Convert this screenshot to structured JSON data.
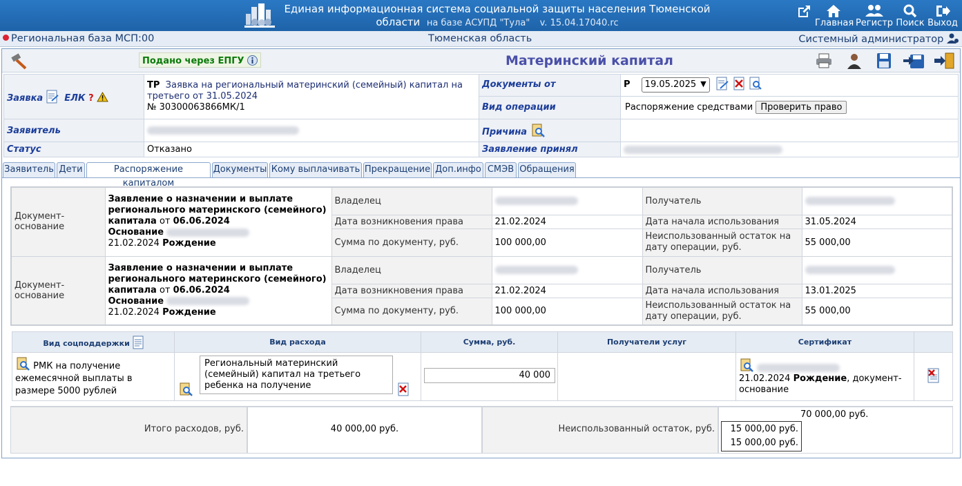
{
  "header": {
    "title_line1": "Единая информационная система социальной защиты населения Тюменской",
    "title_line2": "области",
    "base": "на базе АСУПД \"Тула\"",
    "version": "v. 15.04.17040.rc",
    "nav": [
      {
        "label": "Главная",
        "icon": "home-icon"
      },
      {
        "label": "Регистр",
        "icon": "users-icon"
      },
      {
        "label": "Поиск",
        "icon": "search-icon"
      },
      {
        "label": "Выход",
        "icon": "exit-icon"
      }
    ]
  },
  "status": {
    "db": "Региональная база МСП:00",
    "region": "Тюменская область",
    "user": "Системный администратор"
  },
  "toolbar": {
    "epgu": "Подано через ЕПГУ",
    "page_title": "Материнский капитал"
  },
  "form": {
    "zayavka_label": "Заявка",
    "elk_label": "ЕЛК",
    "zayavka_code": "ТР",
    "zayavka_text": "Заявка на региональный материнский (семейный) капитал на третьего от 31.05.2024",
    "zayavka_num": "№ 30300063866МК/1",
    "applicant_label": "Заявитель",
    "status_label": "Статус",
    "status_value": "Отказано",
    "docs_from_label": "Документы от",
    "docs_from_prefix": "Р",
    "docs_from_date": "19.05.2025",
    "op_label": "Вид операции",
    "op_value": "Распоряжение средствами",
    "check_button": "Проверить право",
    "reason_label": "Причина",
    "accepted_label": "Заявление принял"
  },
  "tabs": [
    "Заявитель",
    "Дети",
    "Распоряжение капиталом",
    "Документы",
    "Кому выплачивать",
    "Прекращение",
    "Доп.инфо",
    "СМЭВ",
    "Обращения"
  ],
  "active_tab": "Распоряжение капиталом",
  "docs": [
    {
      "type": "Документ-основание",
      "name_bold": "Заявление о назначении и выплате регионального материнского (семейного) капитала",
      "from": "от",
      "date": "06.06.2024",
      "basis_label": "Основание",
      "basis_date": "21.02.2024",
      "basis_event": "Рождение",
      "owner_label": "Владелец",
      "recipient_label": "Получатель",
      "right_date_label": "Дата возникновения права",
      "right_date": "21.02.2024",
      "use_start_label": "Дата начала использования",
      "use_start": "31.05.2024",
      "sum_label": "Сумма по документу, руб.",
      "sum": "100 000,00",
      "rest_label": "Неиспользованный остаток на дату операции, руб.",
      "rest": "55 000,00"
    },
    {
      "type": "Документ-основание",
      "name_bold": "Заявление о назначении и выплате регионального материнского (семейного) капитала",
      "from": "от",
      "date": "06.06.2024",
      "basis_label": "Основание",
      "basis_date": "21.02.2024",
      "basis_event": "Рождение",
      "owner_label": "Владелец",
      "recipient_label": "Получатель",
      "right_date_label": "Дата возникновения права",
      "right_date": "21.02.2024",
      "use_start_label": "Дата начала использования",
      "use_start": "13.01.2025",
      "sum_label": "Сумма по документу, руб.",
      "sum": "100 000,00",
      "rest_label": "Неиспользованный остаток на дату операции, руб.",
      "rest": "55 000,00"
    }
  ],
  "support_table": {
    "headers": [
      "Вид соцподдержки",
      "Вид расхода",
      "Сумма, руб.",
      "Получатели услуг",
      "Сертификат"
    ],
    "row": {
      "support_type": "РМК на получение ежемесячной выплаты в размере 5000 рублей",
      "expense": "Региональный материнский (семейный) капитал на третьего ребенка на получение",
      "amount": "40 000",
      "cert_date": "21.02.2024",
      "cert_event": "Рождение",
      "cert_suffix": ", документ-основание"
    }
  },
  "totals": {
    "expenses_label": "Итого расходов, руб.",
    "expenses_value": "40 000,00 руб.",
    "rest_label": "Неиспользованный остаток, руб.",
    "rest_top": "70 000,00 руб.",
    "rest_line1": "15 000,00 руб.",
    "rest_line2": "15 000,00 руб."
  }
}
